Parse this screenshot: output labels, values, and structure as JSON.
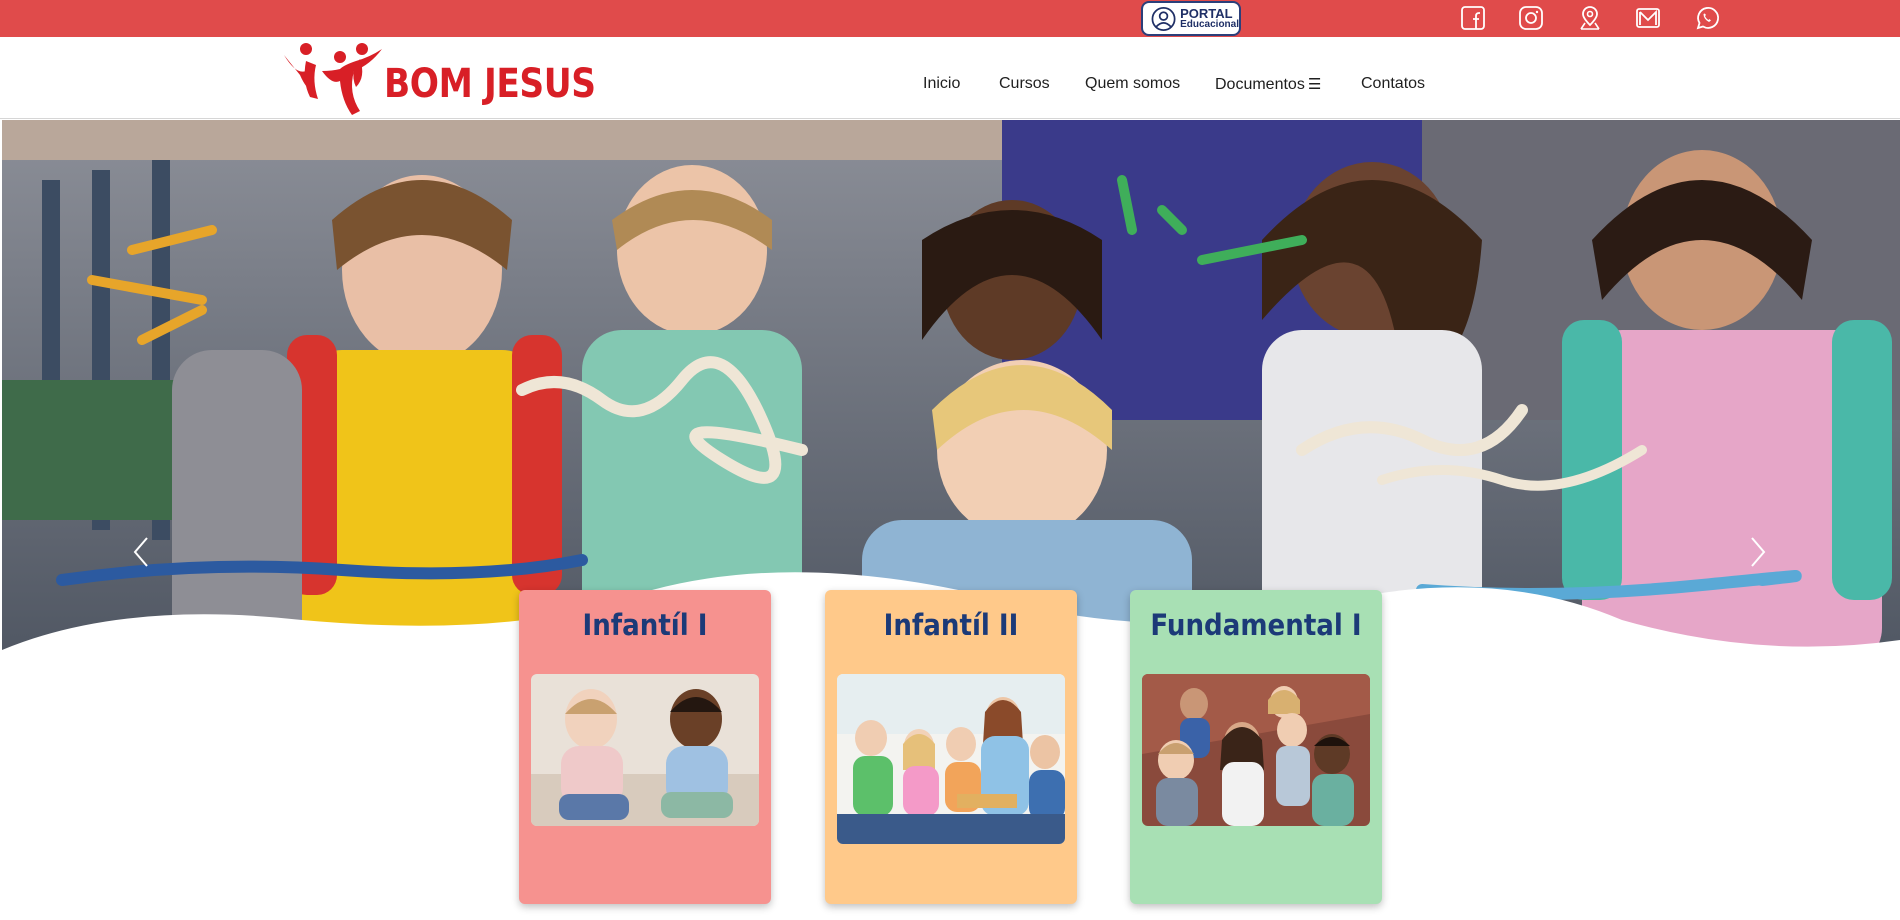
{
  "topbar": {
    "portal": {
      "line1": "PORTAL",
      "line2": "Educacional",
      "icon": "user-circle-icon"
    },
    "social": [
      {
        "name": "facebook-icon"
      },
      {
        "name": "instagram-icon"
      },
      {
        "name": "map-pin-icon"
      },
      {
        "name": "email-icon"
      },
      {
        "name": "whatsapp-icon"
      }
    ],
    "colors": {
      "bar": "#e04b4b",
      "portal_border": "#2b3f7a"
    }
  },
  "header": {
    "logo_text": "BOM JESUS",
    "nav": [
      {
        "label": "Inicio"
      },
      {
        "label": "Cursos"
      },
      {
        "label": "Quem somos"
      },
      {
        "label": "Documentos",
        "icon": "☰"
      },
      {
        "label": "Contatos"
      }
    ],
    "colors": {
      "brand": "#d81f26"
    }
  },
  "hero": {
    "image": "children-with-backpacks-photo",
    "prev_icon": "chevron-left-icon",
    "next_icon": "chevron-right-icon"
  },
  "cards": [
    {
      "title": "Infantíl I",
      "image": "two-toddlers-playing-photo",
      "color": "#f6928f"
    },
    {
      "title": "Infantíl II",
      "image": "teacher-reading-to-kids-photo",
      "color": "#ffc98a"
    },
    {
      "title": "Fundamental I",
      "image": "group-of-schoolchildren-photo",
      "color": "#a8e0b4"
    }
  ]
}
